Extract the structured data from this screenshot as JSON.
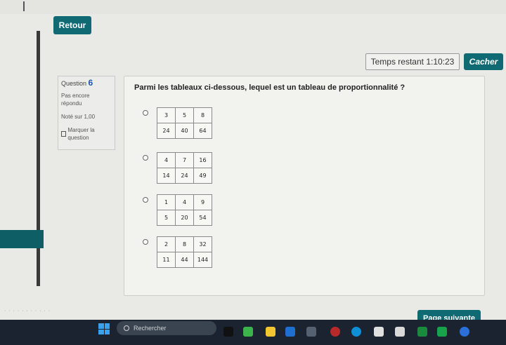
{
  "nav": {
    "back_label": "Retour"
  },
  "timer": {
    "text": "Temps restant 1:10:23",
    "hide_label": "Cacher"
  },
  "question_info": {
    "label": "Question",
    "number": "6",
    "status": "Pas encore répondu",
    "score": "Noté sur 1,00",
    "flag_label": "Marquer la question"
  },
  "question": {
    "text": "Parmi les tableaux ci-dessous, lequel est un tableau de proportionnalité ?",
    "options": [
      {
        "row1": [
          "3",
          "5",
          "8"
        ],
        "row2": [
          "24",
          "40",
          "64"
        ]
      },
      {
        "row1": [
          "4",
          "7",
          "16"
        ],
        "row2": [
          "14",
          "24",
          "49"
        ]
      },
      {
        "row1": [
          "1",
          "4",
          "9"
        ],
        "row2": [
          "5",
          "20",
          "54"
        ]
      },
      {
        "row1": [
          "2",
          "8",
          "32"
        ],
        "row2": [
          "11",
          "44",
          "144"
        ]
      }
    ]
  },
  "next_label": "Page suivante",
  "taskbar": {
    "search_placeholder": "Rechercher"
  },
  "colors": {
    "accent": "#0f6a74",
    "taskbar": "#1b2330"
  }
}
